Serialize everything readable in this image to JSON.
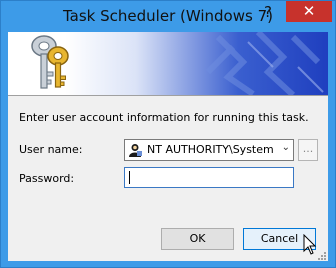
{
  "window": {
    "title": "Task Scheduler (Windows 7)",
    "help_glyph": "?",
    "close_glyph": "✕"
  },
  "dialog": {
    "prompt": "Enter user account information for running this task.",
    "user_name_label": "User name:",
    "user_name_value": "NT AUTHORITY\\System",
    "browse_label": "...",
    "password_label": "Password:",
    "password_value": ""
  },
  "buttons": {
    "ok": "OK",
    "cancel": "Cancel"
  },
  "colors": {
    "titlebar": "#3d9be8",
    "close_button": "#c7322c",
    "dialog_background": "#f0f0f0",
    "focus_border": "#0078d7"
  },
  "icons": [
    "keys-icon",
    "user-account-icon",
    "chevron-down-icon",
    "mouse-cursor-icon"
  ]
}
